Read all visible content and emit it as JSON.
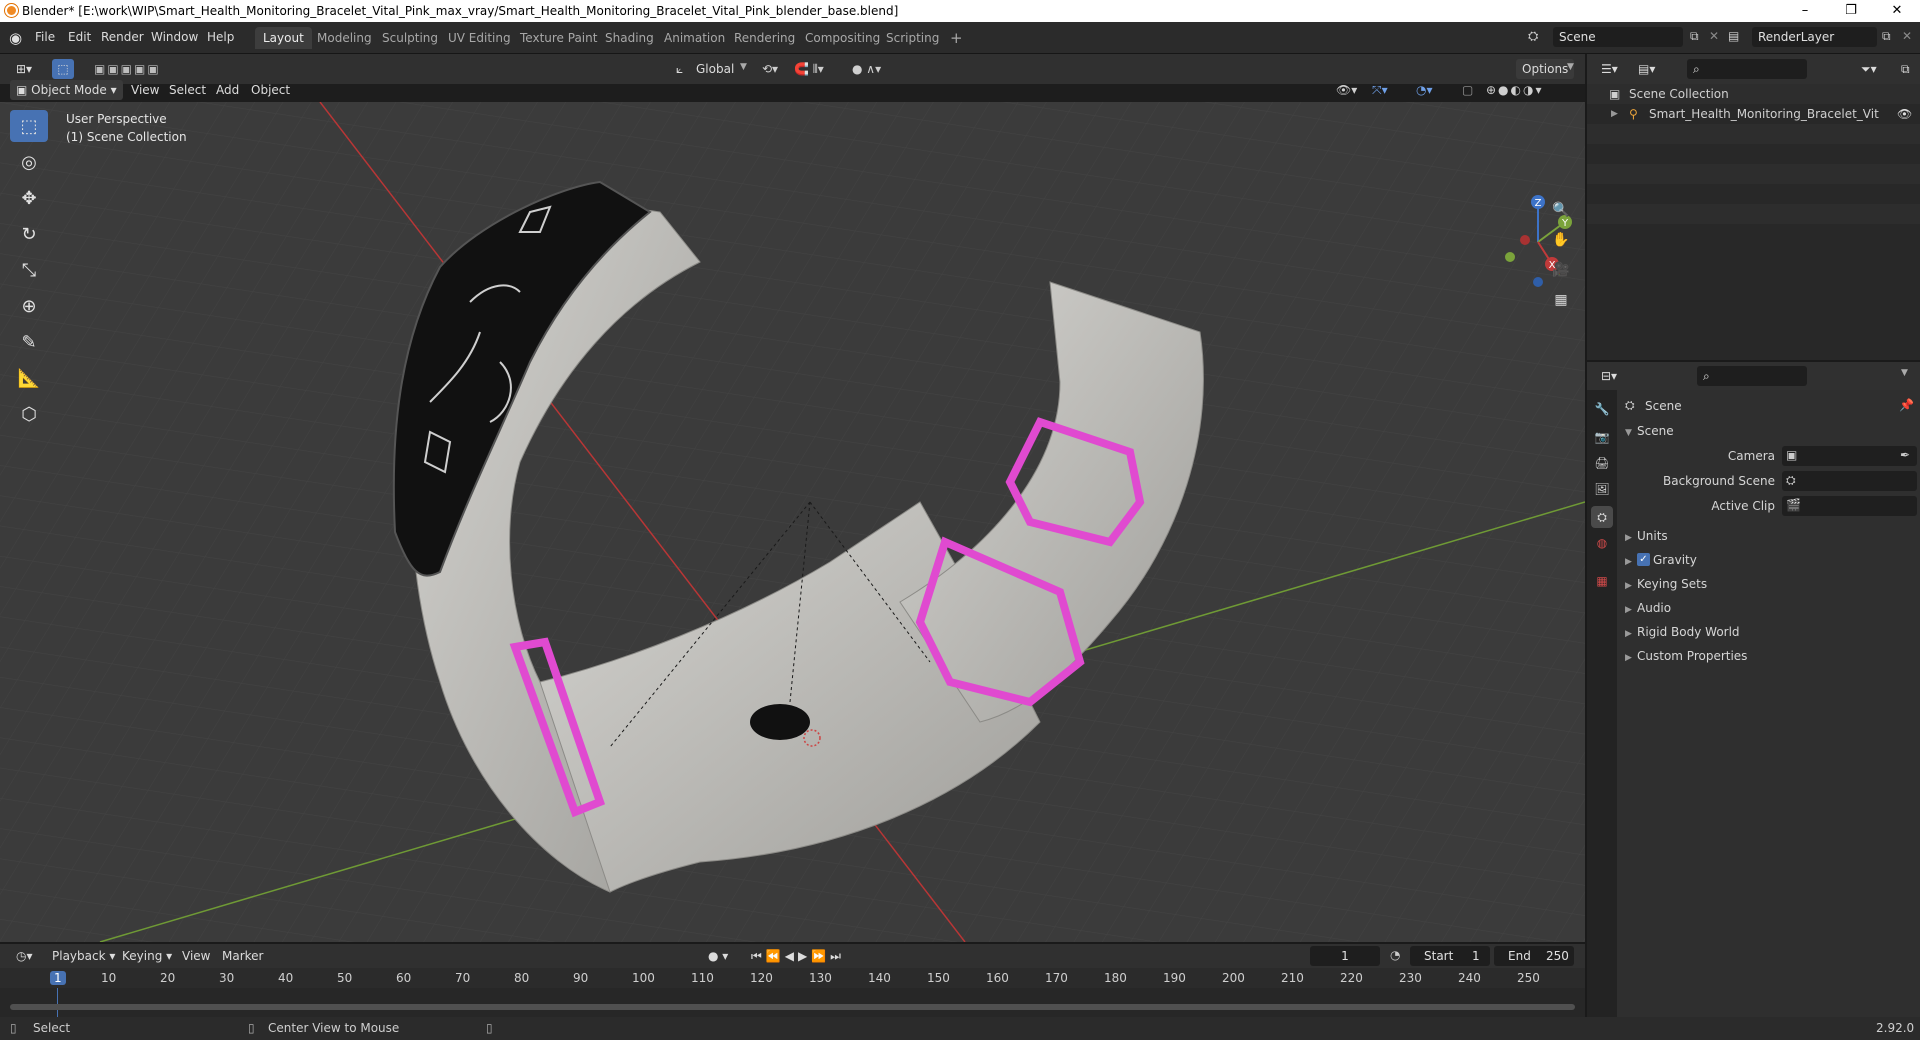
{
  "window": {
    "title": "Blender* [E:\\work\\WIP\\Smart_Health_Monitoring_Bracelet_Vital_Pink_max_vray/Smart_Health_Monitoring_Bracelet_Vital_Pink_blender_base.blend]",
    "controls": {
      "minimize": "–",
      "restore": "❐",
      "close": "✕"
    }
  },
  "menubar": {
    "items": [
      "File",
      "Edit",
      "Render",
      "Window",
      "Help"
    ],
    "workspaces": [
      "Layout",
      "Modeling",
      "Sculpting",
      "UV Editing",
      "Texture Paint",
      "Shading",
      "Animation",
      "Rendering",
      "Compositing",
      "Scripting"
    ],
    "active_workspace": "Layout",
    "add_tab": "+",
    "scene": "Scene",
    "render_layer": "RenderLayer"
  },
  "viewport_header": {
    "orientation": "Global",
    "options": "Options",
    "mode": "Object Mode",
    "menus": [
      "View",
      "Select",
      "Add",
      "Object"
    ]
  },
  "viewport": {
    "perspective": "User Perspective",
    "collection": "(1) Scene Collection",
    "gizmo": {
      "x": "X",
      "y": "Y",
      "z": "Z"
    },
    "colors": {
      "x_axis": "#c03a3a",
      "y_axis": "#7ba33b",
      "z_axis": "#3d73c8",
      "bg": "#3b3b3b",
      "pink": "#e04ad0"
    }
  },
  "outliner": {
    "root": "Scene Collection",
    "items": [
      {
        "label": "Smart_Health_Monitoring_Bracelet_Vital_Pir"
      }
    ]
  },
  "properties": {
    "header": "Scene",
    "panel_title": "Scene",
    "fields": [
      {
        "label": "Camera"
      },
      {
        "label": "Background Scene"
      },
      {
        "label": "Active Clip"
      }
    ],
    "sections": [
      "Units",
      "Gravity",
      "Keying Sets",
      "Audio",
      "Rigid Body World",
      "Custom Properties"
    ],
    "gravity_checked": true
  },
  "timeline": {
    "menus": [
      "Playback",
      "Keying",
      "View",
      "Marker"
    ],
    "current_frame": "1",
    "start_label": "Start",
    "start": "1",
    "end_label": "End",
    "end": "250",
    "ticks": [
      "1",
      "10",
      "20",
      "30",
      "40",
      "50",
      "60",
      "70",
      "80",
      "90",
      "100",
      "110",
      "120",
      "130",
      "140",
      "150",
      "160",
      "170",
      "180",
      "190",
      "200",
      "210",
      "220",
      "230",
      "240",
      "250"
    ]
  },
  "statusbar": {
    "left": "Select",
    "middle": "Center View to Mouse",
    "version": "2.92.0"
  }
}
